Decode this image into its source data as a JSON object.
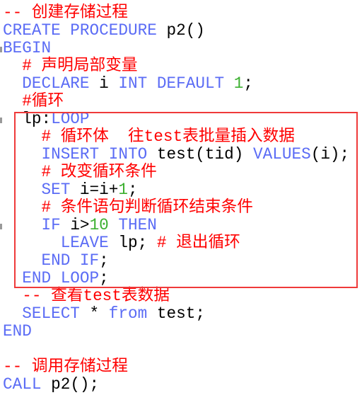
{
  "lines": [
    [
      [
        "cm",
        "-- 创建存储过程"
      ]
    ],
    [
      [
        "kw",
        "CREATE PROCEDURE"
      ],
      [
        "tx",
        " p2()"
      ]
    ],
    [
      [
        "kw",
        "BEGIN"
      ]
    ],
    [
      [
        "cm",
        "  # 声明局部变量"
      ]
    ],
    [
      [
        "kw",
        "  DECLARE"
      ],
      [
        "tx",
        " i "
      ],
      [
        "kw",
        "INT DEFAULT"
      ],
      [
        "tx",
        " "
      ],
      [
        "num",
        "1"
      ],
      [
        "tx",
        ";"
      ]
    ],
    [
      [
        "cm",
        "  #循环"
      ]
    ],
    [
      [
        "tx",
        "  lp:"
      ],
      [
        "kw",
        "LOOP"
      ]
    ],
    [
      [
        "cm",
        "    # 循环体  往test表批量插入数据"
      ]
    ],
    [
      [
        "kw",
        "    INSERT INTO"
      ],
      [
        "tx",
        " test(tid) "
      ],
      [
        "kw",
        "VALUES"
      ],
      [
        "tx",
        "(i);"
      ]
    ],
    [
      [
        "cm",
        "    # 改变循环条件"
      ]
    ],
    [
      [
        "kw",
        "    SET"
      ],
      [
        "tx",
        " i=i+"
      ],
      [
        "num",
        "1"
      ],
      [
        "tx",
        ";"
      ]
    ],
    [
      [
        "cm",
        "    # 条件语句判断循环结束条件"
      ]
    ],
    [
      [
        "kw",
        "    IF"
      ],
      [
        "tx",
        " i>"
      ],
      [
        "num",
        "10"
      ],
      [
        "tx",
        " "
      ],
      [
        "kw",
        "THEN"
      ]
    ],
    [
      [
        "kw",
        "      LEAVE"
      ],
      [
        "tx",
        " lp; "
      ],
      [
        "cm",
        "# 退出循环"
      ]
    ],
    [
      [
        "kw",
        "    END IF"
      ],
      [
        "tx",
        ";"
      ]
    ],
    [
      [
        "kw",
        "  END LOOP"
      ],
      [
        "tx",
        ";"
      ]
    ],
    [
      [
        "cm",
        "  -- 查看test表数据"
      ]
    ],
    [
      [
        "kw",
        "  SELECT"
      ],
      [
        "tx",
        " * "
      ],
      [
        "kw",
        "from"
      ],
      [
        "tx",
        " test;"
      ]
    ],
    [
      [
        "kw",
        "END"
      ]
    ],
    [],
    [
      [
        "cm",
        "-- 调用存储过程"
      ]
    ],
    [
      [
        "kw",
        "CALL"
      ],
      [
        "tx",
        " p2();"
      ]
    ]
  ]
}
